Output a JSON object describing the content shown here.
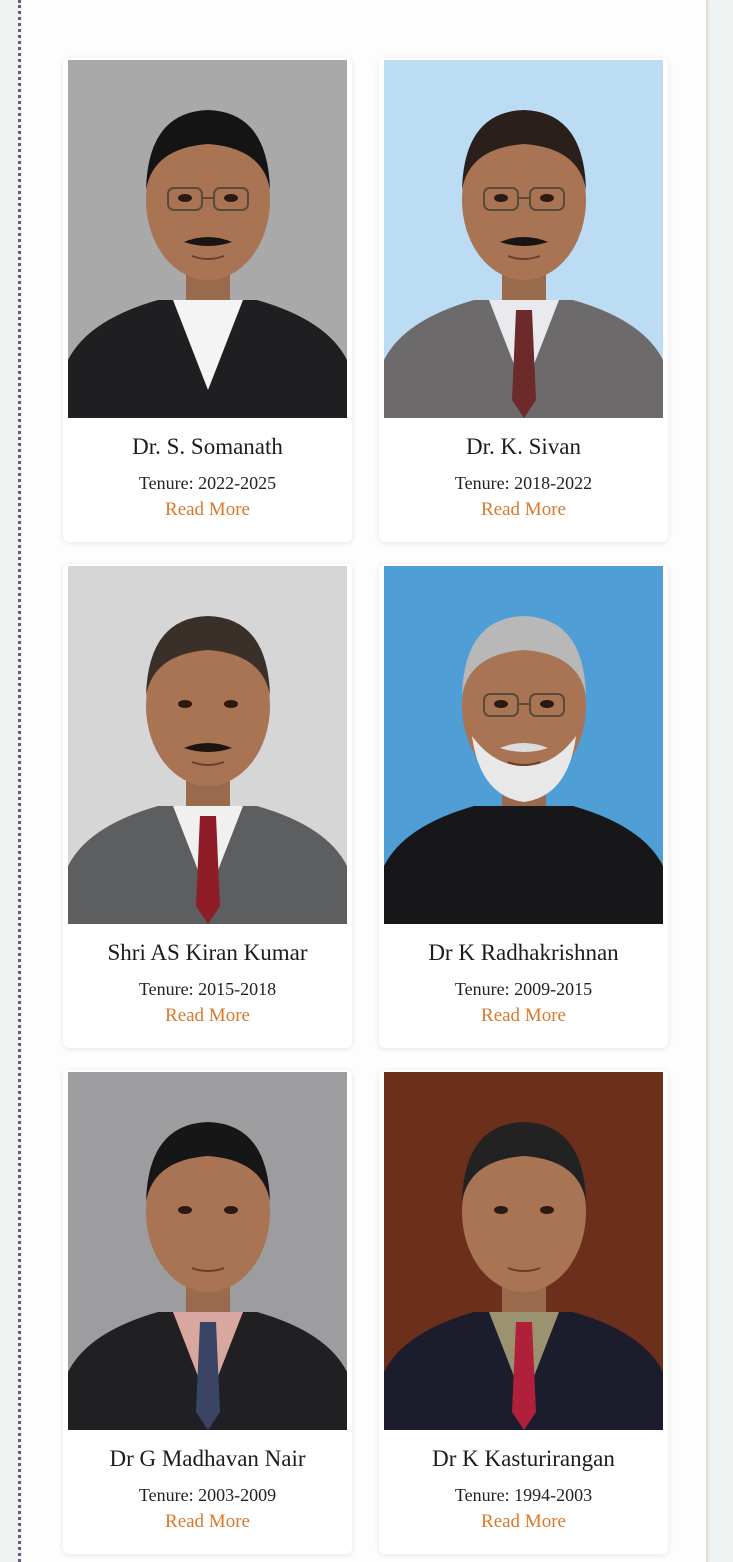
{
  "chairpersons": [
    {
      "name": "Dr. S. Somanath",
      "tenure": "Tenure: 2022-2025",
      "link": "Read More",
      "bg": "#a9a9a9",
      "suit": "#1f1f22",
      "shirt": "#f4f4f4",
      "tie": "",
      "hair": "#141414",
      "mustache": true,
      "beard": false,
      "glasses": true,
      "jacket": "open"
    },
    {
      "name": "Dr. K. Sivan",
      "tenure": "Tenure: 2018-2022",
      "link": "Read More",
      "bg": "#bcdcf4",
      "suit": "#6c6a6a",
      "shirt": "#eaeaee",
      "tie": "#6d2a2a",
      "hair": "#2a1f1a",
      "mustache": true,
      "beard": false,
      "glasses": true,
      "jacket": "suit"
    },
    {
      "name": "Shri AS Kiran Kumar",
      "tenure": "Tenure: 2015-2018",
      "link": "Read More",
      "bg": "#d6d6d6",
      "suit": "#5c5e60",
      "shirt": "#f0f0f0",
      "tie": "#8e1d28",
      "hair": "#3a302a",
      "mustache": true,
      "beard": false,
      "glasses": false,
      "jacket": "suit"
    },
    {
      "name": "Dr K Radhakrishnan",
      "tenure": "Tenure: 2009-2015",
      "link": "Read More",
      "bg": "#4f9fd6",
      "suit": "#17171a",
      "shirt": "#17171a",
      "tie": "",
      "hair": "#b8b8b8",
      "mustache": true,
      "beard": true,
      "glasses": true,
      "jacket": "bandh"
    },
    {
      "name": "Dr G Madhavan Nair",
      "tenure": "Tenure: 2003-2009",
      "link": "Read More",
      "bg": "#9d9d9f",
      "suit": "#202022",
      "shirt": "#d8a8a0",
      "tie": "#3c4466",
      "hair": "#161616",
      "mustache": false,
      "beard": false,
      "glasses": false,
      "jacket": "suit"
    },
    {
      "name": "Dr K Kasturirangan",
      "tenure": "Tenure: 1994-2003",
      "link": "Read More",
      "bg": "#6b2f1c",
      "suit": "#1b1c2c",
      "shirt": "#9b9270",
      "tie": "#b0203a",
      "hair": "#222",
      "mustache": false,
      "beard": false,
      "glasses": false,
      "jacket": "suit"
    }
  ],
  "icons": {
    "portrait": "person-portrait-photo"
  }
}
